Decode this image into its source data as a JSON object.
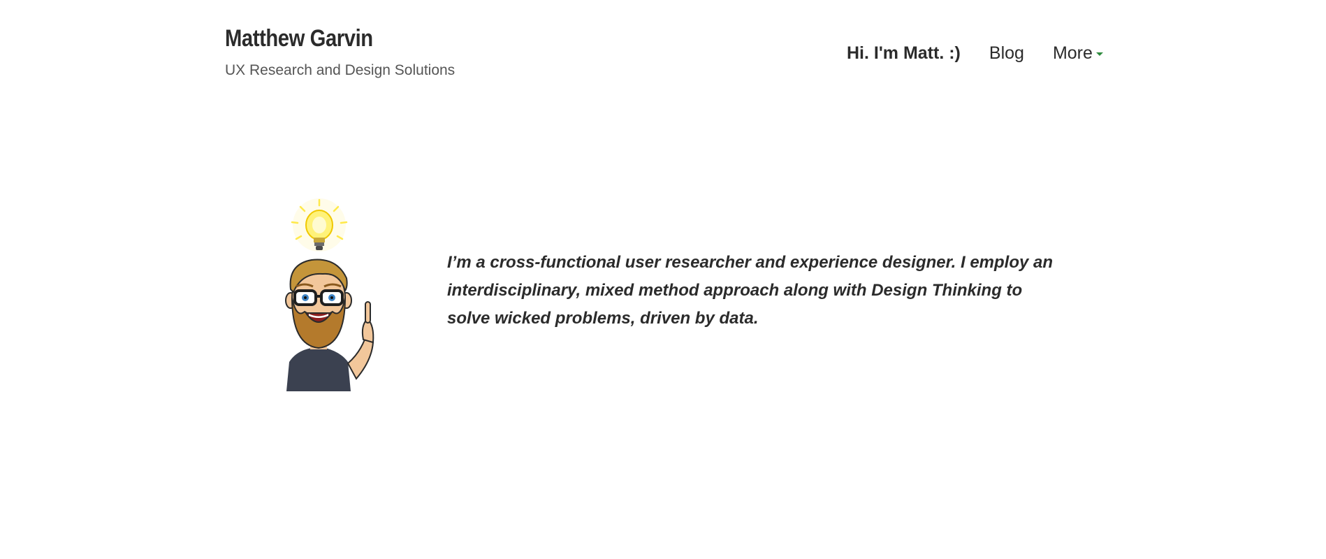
{
  "site": {
    "title": "Matthew Garvin",
    "tagline": "UX Research and Design Solutions"
  },
  "nav": {
    "items": [
      {
        "label": "Hi. I'm Matt. :)",
        "active": true
      },
      {
        "label": "Blog",
        "active": false
      },
      {
        "label": "More",
        "active": false,
        "has_dropdown": true
      }
    ]
  },
  "hero": {
    "avatar_icon": "bitmoji-avatar-lightbulb-icon",
    "intro": "I’m a cross-functional user researcher and experience designer. I employ an interdisciplinary, mixed method approach along with Design Thinking to solve wicked problems, driven by data."
  },
  "colors": {
    "text": "#2b2b2b",
    "tagline": "#555555",
    "accent": "#2e8b3e",
    "background": "#ffffff"
  }
}
